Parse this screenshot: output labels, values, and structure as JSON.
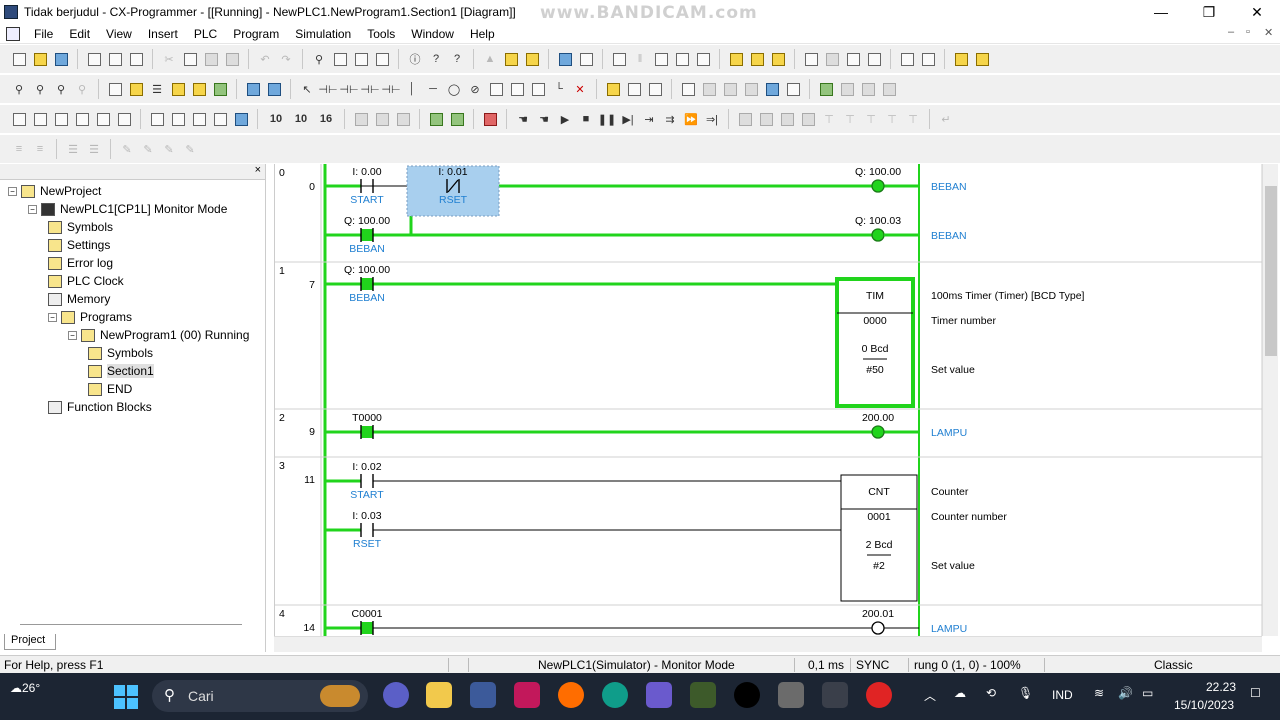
{
  "window": {
    "title": "Tidak berjudul - CX-Programmer - [[Running] - NewPLC1.NewProgram1.Section1 [Diagram]]",
    "watermark": "www.BANDICAM.com",
    "minimize": "—",
    "maximize": "❐",
    "close": "✕"
  },
  "menu": [
    "File",
    "Edit",
    "View",
    "Insert",
    "PLC",
    "Program",
    "Simulation",
    "Tools",
    "Window",
    "Help"
  ],
  "mdi_controls": [
    "–",
    "▫",
    "✕"
  ],
  "toolbar_zoom": [
    "10",
    "10",
    "16"
  ],
  "project_tree": {
    "close_label": "×",
    "items": [
      {
        "label": "NewProject",
        "level": 0,
        "toggle": "⊟",
        "icon": "project-icon"
      },
      {
        "label": "NewPLC1[CP1L] Monitor Mode",
        "level": 1,
        "toggle": "⊟",
        "icon": "plc-icon"
      },
      {
        "label": "Symbols",
        "level": 2,
        "toggle": "",
        "icon": "symbols-icon"
      },
      {
        "label": "Settings",
        "level": 2,
        "toggle": "",
        "icon": "settings-icon"
      },
      {
        "label": "Error log",
        "level": 2,
        "toggle": "",
        "icon": "error-log-icon"
      },
      {
        "label": "PLC Clock",
        "level": 2,
        "toggle": "",
        "icon": "clock-icon"
      },
      {
        "label": "Memory",
        "level": 2,
        "toggle": "",
        "icon": "memory-icon"
      },
      {
        "label": "Programs",
        "level": 2,
        "toggle": "⊟",
        "icon": "programs-icon"
      },
      {
        "label": "NewProgram1 (00) Running",
        "level": 3,
        "toggle": "⊟",
        "icon": "program-icon"
      },
      {
        "label": "Symbols",
        "level": 4,
        "toggle": "",
        "icon": "symbols-icon"
      },
      {
        "label": "Section1",
        "level": 4,
        "toggle": "",
        "icon": "section-icon"
      },
      {
        "label": "END",
        "level": 4,
        "toggle": "",
        "icon": "end-icon"
      },
      {
        "label": "Function Blocks",
        "level": 2,
        "toggle": "",
        "icon": "function-blocks-icon"
      }
    ],
    "tab": "Project"
  },
  "ladder": {
    "rungs": [
      {
        "rung": "0",
        "step": "0",
        "contacts": [
          {
            "addr": "I: 0.00",
            "sym": "START",
            "type": "NO",
            "state": "off"
          },
          {
            "addr": "I: 0.01",
            "sym": "RSET",
            "type": "NC",
            "state": "on",
            "selected": true
          },
          {
            "addr": "Q: 100.00",
            "sym": "BEBAN",
            "type": "NO",
            "state": "on"
          }
        ],
        "coils": [
          {
            "addr": "Q: 100.00",
            "comment": "BEBAN",
            "state": "on"
          },
          {
            "addr": "Q: 100.03",
            "comment": "BEBAN",
            "state": "on"
          }
        ]
      },
      {
        "rung": "1",
        "step": "7",
        "contacts": [
          {
            "addr": "Q: 100.00",
            "sym": "BEBAN",
            "type": "NO",
            "state": "on"
          }
        ],
        "block": {
          "name": "TIM",
          "number": "0000",
          "pv": "0 Bcd",
          "sv": "#50",
          "state": "on",
          "comments": [
            "100ms Timer (Timer) [BCD Type]",
            "Timer number",
            "Set value"
          ]
        }
      },
      {
        "rung": "2",
        "step": "9",
        "contacts": [
          {
            "addr": "T0000",
            "sym": "",
            "type": "NO",
            "state": "on"
          }
        ],
        "coils": [
          {
            "addr": "200.00",
            "comment": "LAMPU",
            "state": "on"
          }
        ]
      },
      {
        "rung": "3",
        "step": "11",
        "contacts": [
          {
            "addr": "I: 0.02",
            "sym": "START",
            "type": "NO",
            "state": "off"
          },
          {
            "addr": "I: 0.03",
            "sym": "RSET",
            "type": "NO",
            "state": "off"
          }
        ],
        "block": {
          "name": "CNT",
          "number": "0001",
          "pv": "2 Bcd",
          "sv": "#2",
          "state": "off",
          "comments": [
            "Counter",
            "Counter number",
            "Set value"
          ]
        }
      },
      {
        "rung": "4",
        "step": "14",
        "contacts": [
          {
            "addr": "C0001",
            "sym": "",
            "type": "NO",
            "state": "on"
          }
        ],
        "coils": [
          {
            "addr": "200.01",
            "comment": "LAMPU",
            "state": "off"
          }
        ]
      }
    ],
    "colors": {
      "energized": "#21d41c",
      "off": "#000000",
      "comment": "#1f7fd1",
      "select": "#a8cfee"
    }
  },
  "status": {
    "help": "For Help, press F1",
    "mode": "NewPLC1(Simulator) - Monitor Mode",
    "scan": "0,1 ms",
    "sync": "SYNC",
    "rung": "rung 0 (1, 0)  - 100%",
    "style": "Classic"
  },
  "taskbar": {
    "weather": "26°",
    "search_placeholder": "Cari",
    "language": "IND",
    "time": "22.23",
    "date": "15/10/2023"
  }
}
